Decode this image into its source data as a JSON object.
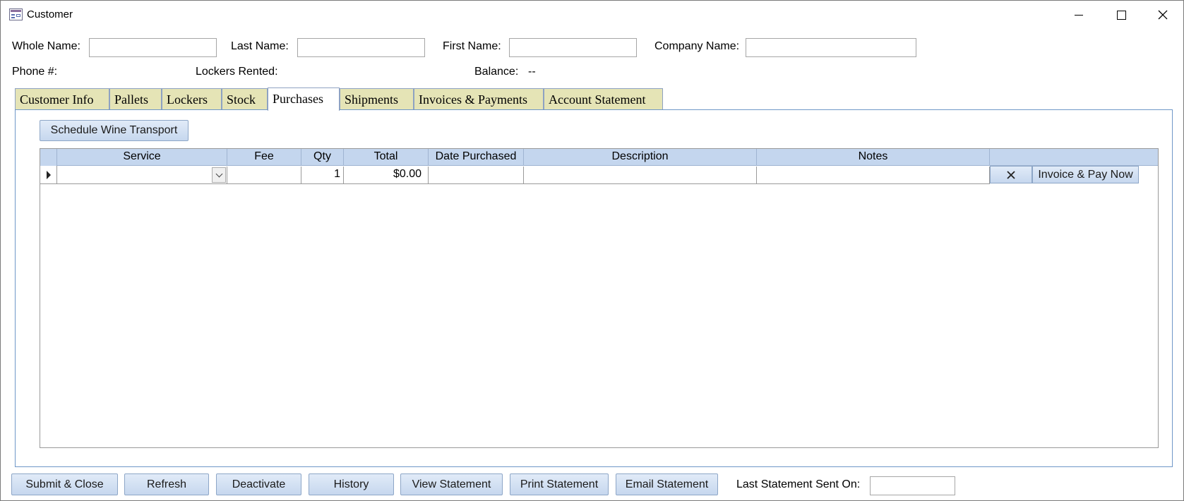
{
  "window": {
    "title": "Customer"
  },
  "header": {
    "whole_name_label": "Whole Name:",
    "whole_name_value": "",
    "last_name_label": "Last Name:",
    "last_name_value": "",
    "first_name_label": "First Name:",
    "first_name_value": "",
    "company_name_label": "Company Name:",
    "company_name_value": "",
    "phone_label": "Phone #:",
    "lockers_label": "Lockers Rented:",
    "balance_label": "Balance:",
    "balance_value": "--"
  },
  "tabs": [
    {
      "label": "Customer Info",
      "active": false
    },
    {
      "label": "Pallets",
      "active": false
    },
    {
      "label": "Lockers",
      "active": false
    },
    {
      "label": "Stock",
      "active": false
    },
    {
      "label": "Purchases",
      "active": true
    },
    {
      "label": "Shipments",
      "active": false
    },
    {
      "label": "Invoices & Payments",
      "active": false
    },
    {
      "label": "Account Statement",
      "active": false
    }
  ],
  "purchases": {
    "schedule_button": "Schedule Wine Transport",
    "columns": [
      "Service",
      "Fee",
      "Qty",
      "Total",
      "Date Purchased",
      "Description",
      "Notes"
    ],
    "rows": [
      {
        "service": "",
        "fee": "",
        "qty": "1",
        "total": "$0.00",
        "date_purchased": "",
        "description": "",
        "notes": "",
        "delete_icon": "x-icon",
        "pay_button": "Invoice & Pay Now"
      }
    ]
  },
  "footer": {
    "submit_close": "Submit & Close",
    "refresh": "Refresh",
    "deactivate": "Deactivate",
    "history": "History",
    "view_statement": "View Statement",
    "print_statement": "Print Statement",
    "email_statement": "Email Statement",
    "last_sent_label": "Last Statement Sent On:",
    "last_sent_value": ""
  },
  "colors": {
    "tab_inactive": "#e5e4b6",
    "grid_header": "#c4d6ee",
    "button_gradient_top": "#e1ebf8",
    "button_gradient_bottom": "#c6d7ee",
    "panel_border": "#6f97c8"
  }
}
